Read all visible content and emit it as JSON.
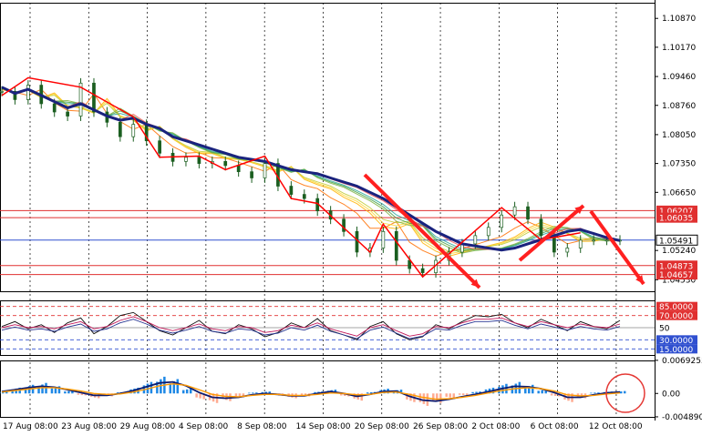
{
  "chart_data": [
    {
      "type": "line",
      "panel": "price",
      "title": "",
      "ylim": [
        1.0425,
        1.1125
      ],
      "y_ticks": [
        "1.10870",
        "1.10170",
        "1.09460",
        "1.08760",
        "1.08050",
        "1.07350",
        "1.06650",
        "1.05240",
        "1.04530"
      ],
      "x_ticks": [
        "17 Aug 08:00",
        "23 Aug 08:00",
        "29 Aug 08:00",
        "4 Sep 08:00",
        "8 Sep 08:00",
        "14 Sep 08:00",
        "20 Sep 08:00",
        "26 Sep 08:00",
        "2 Oct 08:00",
        "6 Oct 08:00",
        "12 Oct 08:00"
      ],
      "horizontal_levels": [
        {
          "value": 1.06207,
          "label": "1.06207",
          "color": "#e03030"
        },
        {
          "value": 1.06035,
          "label": "1.06035",
          "color": "#e03030"
        },
        {
          "value": 1.05491,
          "label": "1.05491",
          "color": "#3050d0"
        },
        {
          "value": 1.04873,
          "label": "1.04873",
          "color": "#e03030"
        },
        {
          "value": 1.04657,
          "label": "1.04657",
          "color": "#e03030"
        }
      ],
      "current_price_label": "1.05491",
      "series": [
        {
          "values": [
            1.092,
            1.0905,
            1.0915,
            1.09,
            1.0885,
            1.087,
            1.088,
            1.0865,
            1.085,
            1.084,
            1.0845,
            1.083,
            1.082,
            1.08,
            1.079,
            1.078,
            1.077,
            1.076,
            1.075,
            1.0745,
            1.074,
            1.073,
            1.072,
            1.0715,
            1.071,
            1.07,
            1.069,
            1.068,
            1.0665,
            1.065,
            1.063,
            1.061,
            1.059,
            1.057,
            1.0555,
            1.054,
            1.0535,
            1.053,
            1.0525,
            1.053,
            1.054,
            1.055,
            1.056,
            1.057,
            1.0575,
            1.0565,
            1.0555,
            1.0548
          ]
        },
        {
          "values": [
            1.091,
            1.089,
            1.0925,
            1.088,
            1.086,
            1.085,
            1.093,
            1.086,
            1.0835,
            1.08,
            1.083,
            1.079,
            1.076,
            1.074,
            1.075,
            1.0735,
            1.074,
            1.073,
            1.0715,
            1.07,
            1.0735,
            1.068,
            1.066,
            1.065,
            1.062,
            1.06,
            1.057,
            1.052,
            1.053,
            1.057,
            1.05,
            1.048,
            1.047,
            1.05,
            1.052,
            1.054,
            1.056,
            1.058,
            1.061,
            1.063,
            1.06,
            1.056,
            1.052,
            1.053,
            1.0549,
            1.0549,
            1.0549,
            1.0549
          ]
        }
      ],
      "grid": "vertical-dashed",
      "colors": {
        "ma_main": "#1a237e",
        "zigzag": "#ff0000",
        "arrows": "#ff2020"
      }
    },
    {
      "type": "line",
      "panel": "oscillator",
      "ylim": [
        5,
        95
      ],
      "levels": [
        {
          "value": 85,
          "label": "85.0000",
          "color": "#e03030"
        },
        {
          "value": 70,
          "label": "70.0000",
          "color": "#e03030"
        },
        {
          "value": 50,
          "label": "50",
          "color": "#888888"
        },
        {
          "value": 30,
          "label": "30.0000",
          "color": "#3050d0"
        },
        {
          "value": 15,
          "label": "15.0000",
          "color": "#3050d0"
        }
      ],
      "series": [
        {
          "values": [
            52,
            60,
            48,
            55,
            42,
            58,
            66,
            40,
            52,
            70,
            75,
            60,
            45,
            38,
            50,
            62,
            44,
            40,
            55,
            48,
            35,
            42,
            58,
            50,
            65,
            45,
            38,
            30,
            52,
            60,
            40,
            30,
            35,
            55,
            48,
            60,
            70,
            68,
            72,
            58,
            50,
            64,
            55,
            45,
            60,
            52,
            48,
            62
          ]
        },
        {
          "values": [
            50,
            55,
            50,
            52,
            48,
            55,
            60,
            48,
            52,
            62,
            68,
            60,
            50,
            45,
            50,
            56,
            48,
            45,
            52,
            50,
            42,
            45,
            54,
            50,
            58,
            48,
            42,
            36,
            50,
            55,
            45,
            36,
            40,
            52,
            50,
            58,
            64,
            64,
            66,
            58,
            52,
            60,
            55,
            50,
            56,
            52,
            50,
            56
          ]
        }
      ]
    },
    {
      "type": "bar",
      "panel": "histogram",
      "y_ticks": [
        "0.0069255",
        "0.00",
        "-0.004890"
      ],
      "ylim": [
        -0.0049,
        0.0069
      ],
      "values": [
        0.0005,
        0.0012,
        0.0018,
        0.0022,
        0.0015,
        0.0006,
        -0.0004,
        -0.001,
        -0.0006,
        0.0003,
        0.0012,
        0.0024,
        0.0035,
        0.003,
        0.001,
        -0.0012,
        -0.002,
        -0.0016,
        -0.0008,
        0.0002,
        0.0004,
        -0.0005,
        -0.001,
        -0.0006,
        0.0004,
        0.0008,
        -0.0006,
        -0.0015,
        0.0003,
        0.001,
        0.0008,
        -0.0018,
        -0.0026,
        -0.002,
        -0.001,
        -0.0004,
        0.0004,
        0.0012,
        0.002,
        0.0024,
        0.0018,
        0.0008,
        -0.0006,
        -0.0018,
        -0.001,
        0.0002,
        0.0004,
        0.0005
      ],
      "series": [
        {
          "values": [
            0.0004,
            0.0008,
            0.0012,
            0.0015,
            0.0013,
            0.0008,
            0.0002,
            -0.0004,
            -0.0004,
            0.0,
            0.0006,
            0.0014,
            0.0022,
            0.0024,
            0.0016,
            0.0002,
            -0.0008,
            -0.001,
            -0.0008,
            -0.0003,
            0.0,
            -0.0002,
            -0.0005,
            -0.0005,
            0.0,
            0.0004,
            0.0,
            -0.0006,
            -0.0002,
            0.0004,
            0.0005,
            -0.0006,
            -0.0014,
            -0.0016,
            -0.0012,
            -0.0007,
            -0.0002,
            0.0004,
            0.001,
            0.0015,
            0.0014,
            0.001,
            0.0002,
            -0.0008,
            -0.0008,
            -0.0003,
            0.0001,
            0.0003
          ]
        },
        {
          "values": [
            0.0003,
            0.0006,
            0.0009,
            0.0012,
            0.0012,
            0.0009,
            0.0005,
            0.0,
            -0.0002,
            -0.0001,
            0.0003,
            0.0009,
            0.0016,
            0.002,
            0.0017,
            0.0008,
            -0.0002,
            -0.0006,
            -0.0007,
            -0.0004,
            -0.0002,
            -0.0002,
            -0.0004,
            -0.0004,
            -0.0002,
            0.0001,
            0.0,
            -0.0003,
            -0.0002,
            0.0002,
            0.0003,
            -0.0002,
            -0.0008,
            -0.0012,
            -0.0011,
            -0.0008,
            -0.0004,
            0.0001,
            0.0006,
            0.001,
            0.0012,
            0.001,
            0.0005,
            -0.0003,
            -0.0005,
            -0.0004,
            -0.0001,
            0.0001
          ]
        }
      ]
    }
  ],
  "colors": {
    "axis_border": "#000000",
    "grid": "#000000",
    "hist_pos": "#1e88e5",
    "hist_neg": "#ffab91",
    "signal_line": "#0d1b6e",
    "slow_line": "#ff9800",
    "osc_line1": "#111111",
    "osc_line2": "#c2185b",
    "osc_line3": "#283593",
    "highlight_circle": "#e53935"
  }
}
